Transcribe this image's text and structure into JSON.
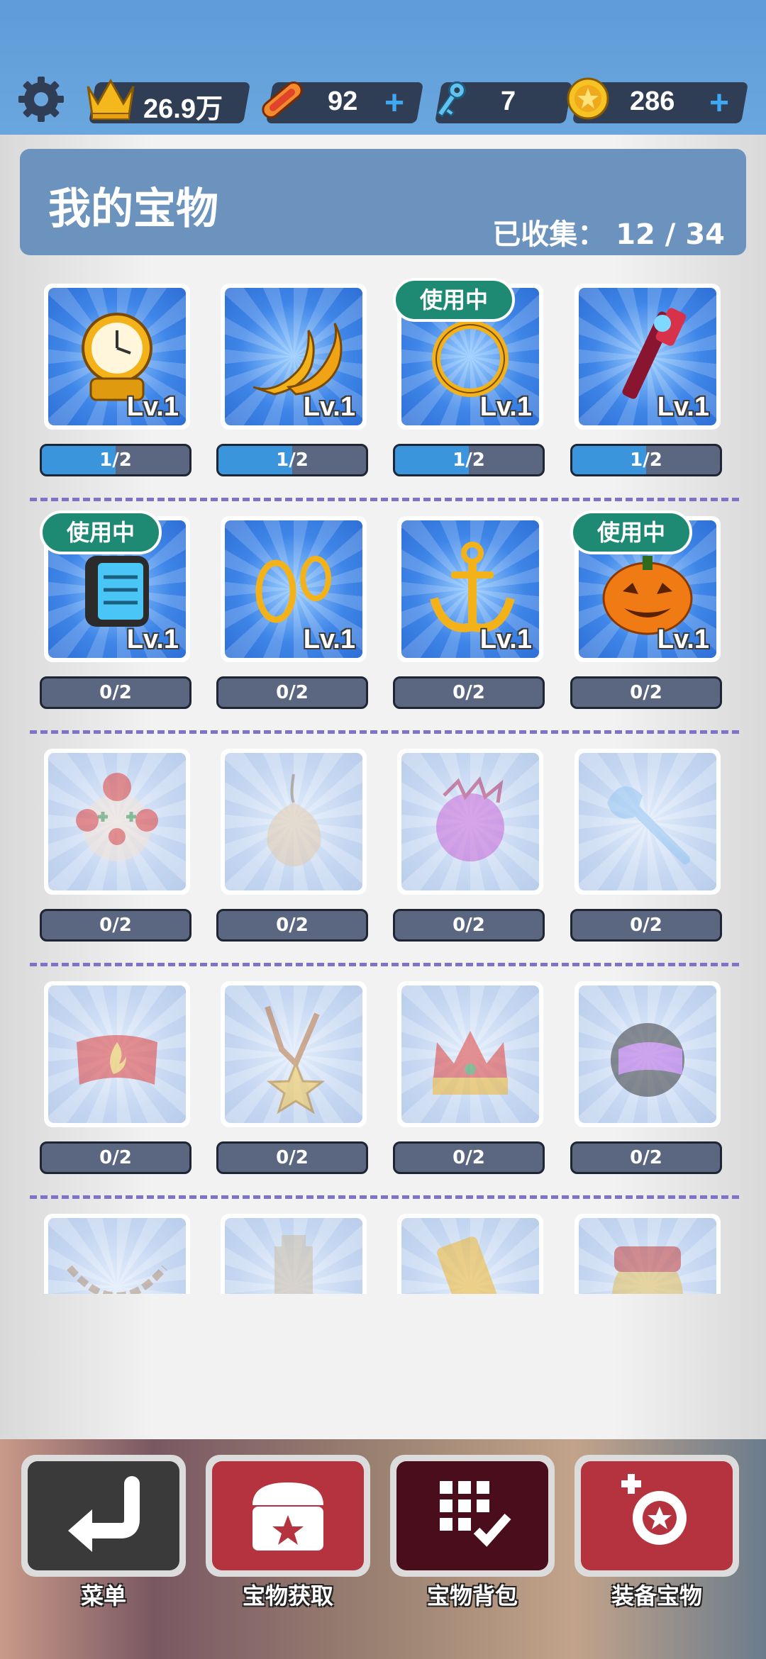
{
  "status_bar": {
    "crowns": "26.9万",
    "boards": "92",
    "keys": "7",
    "coins": "286"
  },
  "header": {
    "title": "我的宝物",
    "collected_label": "已收集：",
    "collected_value": "12 / 34"
  },
  "treasures": [
    {
      "art": "pocket-watch",
      "level": "Lv.1",
      "progress": "1/2",
      "fill": 0.5,
      "in_use": false,
      "locked": false
    },
    {
      "art": "golden-horns",
      "level": "Lv.1",
      "progress": "1/2",
      "fill": 0.5,
      "in_use": false,
      "locked": false
    },
    {
      "art": "golden-ring",
      "level": "Lv.1",
      "progress": "1/2",
      "fill": 0.5,
      "in_use": true,
      "locked": false
    },
    {
      "art": "ghost-wand",
      "level": "Lv.1",
      "progress": "1/2",
      "fill": 0.5,
      "in_use": false,
      "locked": false
    },
    {
      "art": "smart-watch",
      "level": "Lv.1",
      "progress": "0/2",
      "fill": 0,
      "in_use": true,
      "locked": false
    },
    {
      "art": "gold-earrings",
      "level": "Lv.1",
      "progress": "0/2",
      "fill": 0,
      "in_use": false,
      "locked": false
    },
    {
      "art": "anchor",
      "level": "Lv.1",
      "progress": "0/2",
      "fill": 0,
      "in_use": false,
      "locked": false
    },
    {
      "art": "pumpkin",
      "level": "Lv.1",
      "progress": "0/2",
      "fill": 0,
      "in_use": true,
      "locked": false
    },
    {
      "art": "clown-mask",
      "level": "",
      "progress": "0/2",
      "fill": 0,
      "in_use": false,
      "locked": true
    },
    {
      "art": "onion-bulb",
      "level": "",
      "progress": "0/2",
      "fill": 0,
      "in_use": false,
      "locked": true
    },
    {
      "art": "pink-brain",
      "level": "",
      "progress": "0/2",
      "fill": 0,
      "in_use": false,
      "locked": true
    },
    {
      "art": "wind-up-key",
      "level": "",
      "progress": "0/2",
      "fill": 0,
      "in_use": false,
      "locked": true
    },
    {
      "art": "fire-headband",
      "level": "",
      "progress": "0/2",
      "fill": 0,
      "in_use": false,
      "locked": true
    },
    {
      "art": "star-necklace",
      "level": "",
      "progress": "0/2",
      "fill": 0,
      "in_use": false,
      "locked": true
    },
    {
      "art": "crown",
      "level": "",
      "progress": "0/2",
      "fill": 0,
      "in_use": false,
      "locked": true
    },
    {
      "art": "racing-helmet",
      "level": "",
      "progress": "0/2",
      "fill": 0,
      "in_use": false,
      "locked": true
    },
    {
      "art": "chain",
      "level": "",
      "progress": "",
      "fill": 0,
      "in_use": false,
      "locked": true
    },
    {
      "art": "building",
      "level": "",
      "progress": "",
      "fill": 0,
      "in_use": false,
      "locked": true
    },
    {
      "art": "gold-scroll",
      "level": "",
      "progress": "",
      "fill": 0,
      "in_use": false,
      "locked": true
    },
    {
      "art": "red-mask",
      "level": "",
      "progress": "",
      "fill": 0,
      "in_use": false,
      "locked": true
    }
  ],
  "in_use_label": "使用中",
  "nav": [
    {
      "label": "菜单",
      "icon": "return-arrow-icon",
      "color": "#3a3a3a"
    },
    {
      "label": "宝物获取",
      "icon": "treasure-chest-icon",
      "color": "#b5323f"
    },
    {
      "label": "宝物背包",
      "icon": "grid-check-icon",
      "color": "#4a0d1c"
    },
    {
      "label": "装备宝物",
      "icon": "equip-treasure-icon",
      "color": "#b5323f"
    }
  ],
  "colors": {
    "topbar": "#6aa6de",
    "header_panel": "#6b93bd",
    "in_use_badge": "#1f8a74",
    "progress_fill": "#3b95dc",
    "progress_bg": "#5b6780",
    "divider": "#7d73c9"
  }
}
